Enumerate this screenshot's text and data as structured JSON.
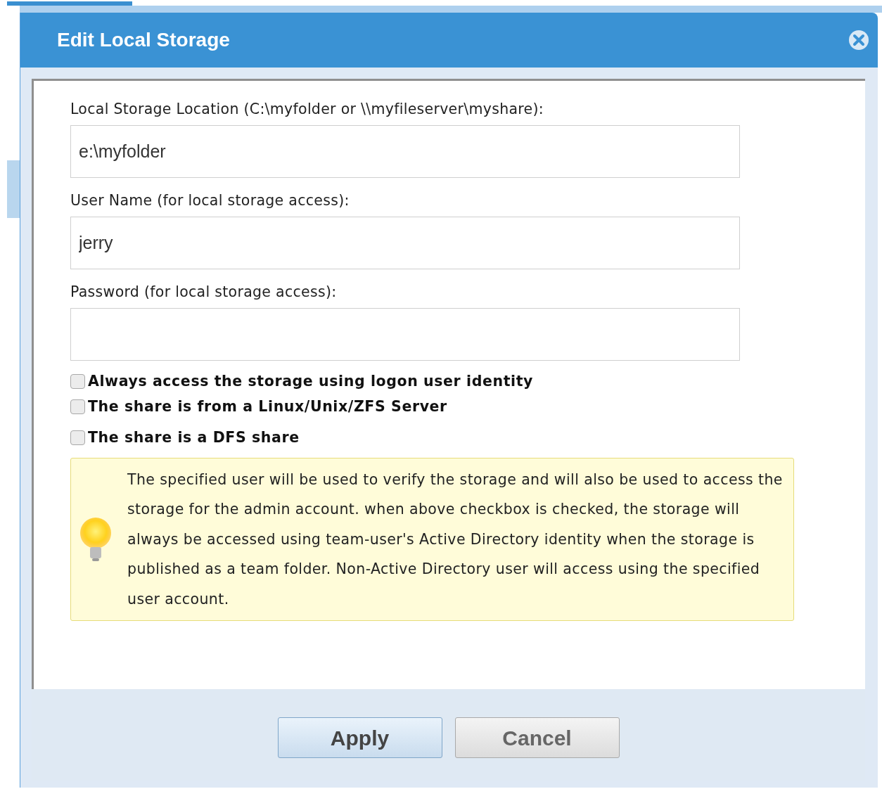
{
  "dialog": {
    "title": "Edit Local Storage"
  },
  "fields": [
    {
      "label": "Local Storage Location (C:\\myfolder or \\\\myfileserver\\myshare):",
      "value": "e:\\myfolder"
    },
    {
      "label": "User Name (for local storage access):",
      "value": "jerry"
    },
    {
      "label": "Password (for local storage access):"
    }
  ],
  "checkboxes": [
    {
      "label": "Always access the storage using logon user identity",
      "checked": false
    },
    {
      "label": "The share is from a Linux/Unix/ZFS Server",
      "checked": false
    },
    {
      "label": "The share is a DFS share",
      "checked": false
    }
  ],
  "note": "The specified user will be used to verify the storage and will also be used to access the storage for the admin account. when above checkbox is checked, the storage will always be accessed using team-user's Active Directory identity when the storage is published as a team folder. Non-Active Directory user will access using the specified user account.",
  "buttons": [
    {
      "label": "Apply",
      "primary": true
    },
    {
      "label": "Cancel",
      "primary": false
    }
  ]
}
